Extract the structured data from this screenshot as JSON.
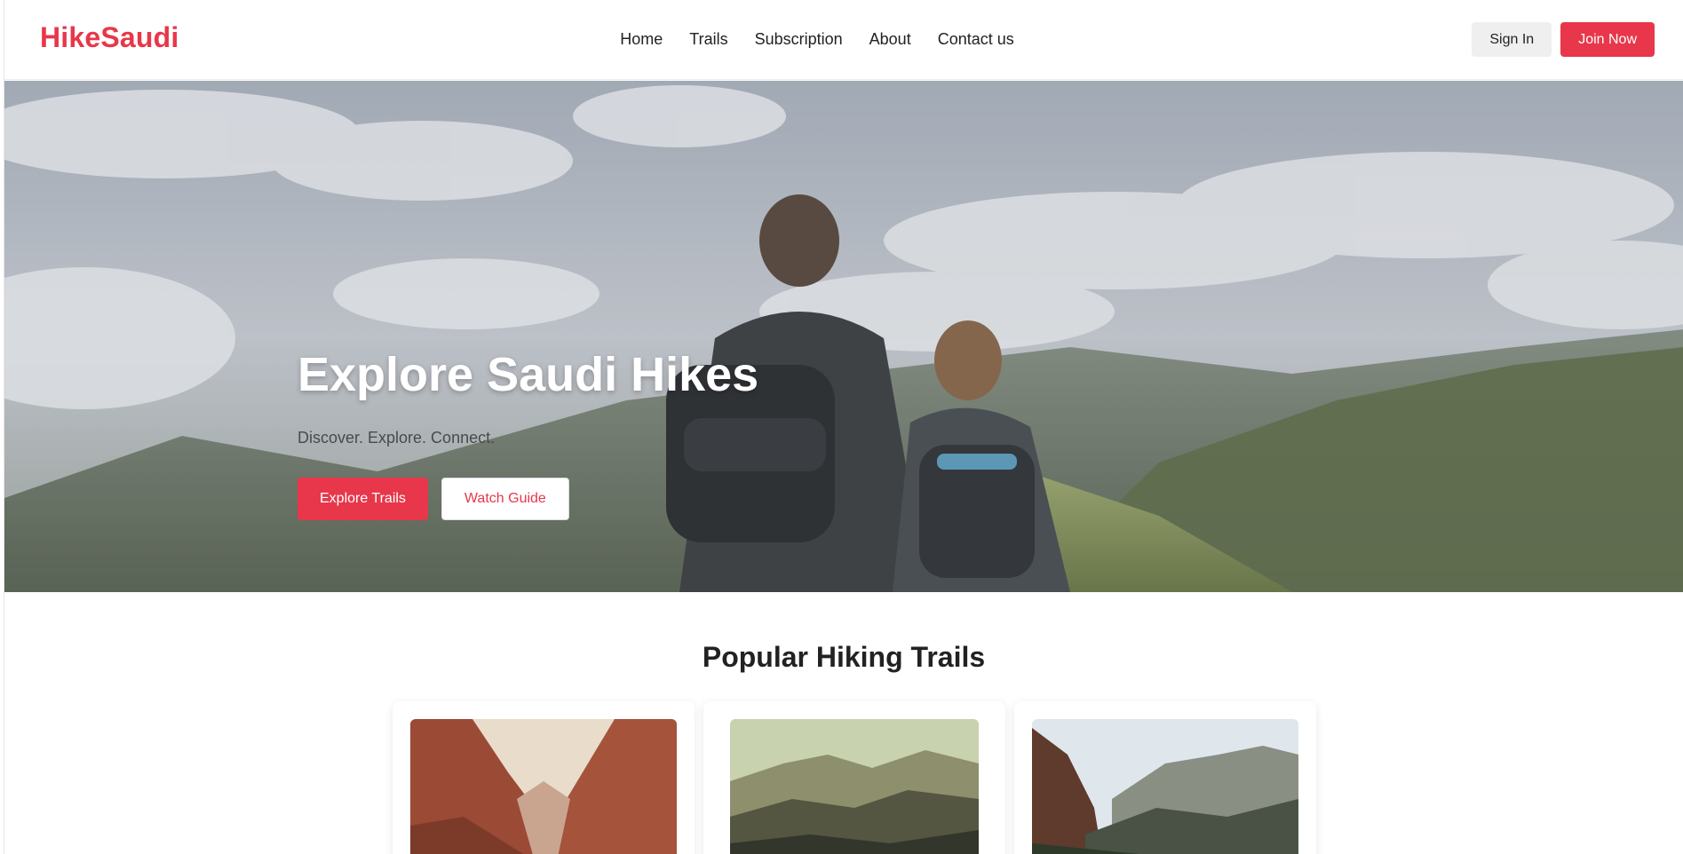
{
  "brand": {
    "logo": "HikeSaudi",
    "accent": "#e8374a"
  },
  "nav": {
    "items": [
      "Home",
      "Trails",
      "Subscription",
      "About",
      "Contact us"
    ]
  },
  "header_actions": {
    "sign_in": "Sign In",
    "join_now": "Join Now"
  },
  "hero": {
    "title": "Explore Saudi Hikes",
    "subtitle": "Discover. Explore. Connect.",
    "primary_button": "Explore Trails",
    "secondary_button": "Watch Guide"
  },
  "trails": {
    "heading": "Popular Hiking Trails"
  }
}
